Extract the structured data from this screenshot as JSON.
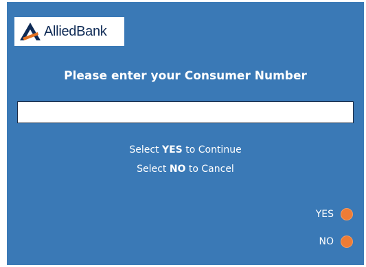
{
  "brand": {
    "name": "AlliedBank",
    "accent_color": "#e37222",
    "logo_color": "#0e2a55"
  },
  "screen": {
    "background_color": "#3a79b6",
    "prompt": "Please enter your Consumer Number"
  },
  "input": {
    "value": "",
    "placeholder": ""
  },
  "instructions": {
    "line1_prefix": "Select",
    "line1_keyword": "YES",
    "line1_suffix": "to Continue",
    "line2_prefix": "Select",
    "line2_keyword": "NO",
    "line2_suffix": "to Cancel"
  },
  "options": {
    "yes_label": "YES",
    "no_label": "NO",
    "indicator_color": "#ee7c35"
  }
}
